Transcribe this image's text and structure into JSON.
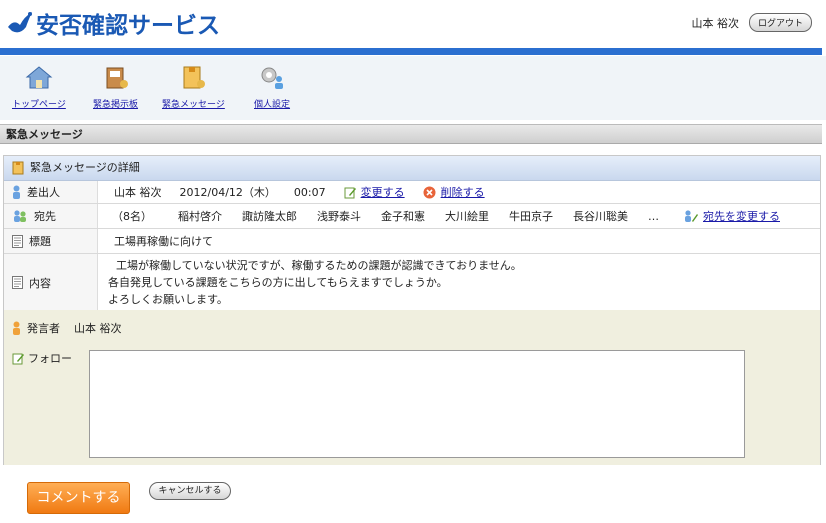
{
  "app": {
    "title": "安否確認サービス"
  },
  "user": {
    "name": "山本 裕次",
    "logout_label": "ログアウト"
  },
  "nav": {
    "items": [
      {
        "label": "トップページ",
        "icon": "house-icon"
      },
      {
        "label": "緊急掲示板",
        "icon": "bulletin-icon"
      },
      {
        "label": "緊急メッセージ",
        "icon": "message-icon"
      },
      {
        "label": "個人設定",
        "icon": "gear-person-icon"
      }
    ]
  },
  "section": {
    "title": "緊急メッセージ"
  },
  "detail": {
    "title": "緊急メッセージの詳細",
    "sender": {
      "label": "差出人",
      "name": "山本 裕次",
      "date": "2012/04/12（木）",
      "time": "00:07",
      "edit_label": "変更する",
      "delete_label": "削除する"
    },
    "recipients": {
      "label": "宛先",
      "count": "（8名）",
      "names": [
        "稲村啓介",
        "諏訪隆太郎",
        "浅野泰斗",
        "金子和憲",
        "大川絵里",
        "牛田京子",
        "長谷川聡美"
      ],
      "more": "…",
      "change_label": "宛先を変更する"
    },
    "subject": {
      "label": "標題",
      "value": "工場再稼働に向けて"
    },
    "content": {
      "label": "内容",
      "lines": [
        "工場が稼働していない状況ですが、稼働するための課題が認識できておりません。",
        "各自発見している課題をこちらの方に出してもらえますでしょうか。",
        "よろしくお願いします。"
      ]
    },
    "speaker": {
      "label": "発言者",
      "name": "山本 裕次"
    },
    "follow": {
      "label": "フォロー",
      "value": ""
    }
  },
  "buttons": {
    "comment": "コメントする",
    "cancel": "キャンセルする"
  },
  "colors": {
    "brand": "#1a59b4",
    "bar": "#2b6fd0",
    "comment_btn": "#f07a12",
    "follow_bg": "#f0efdf"
  }
}
